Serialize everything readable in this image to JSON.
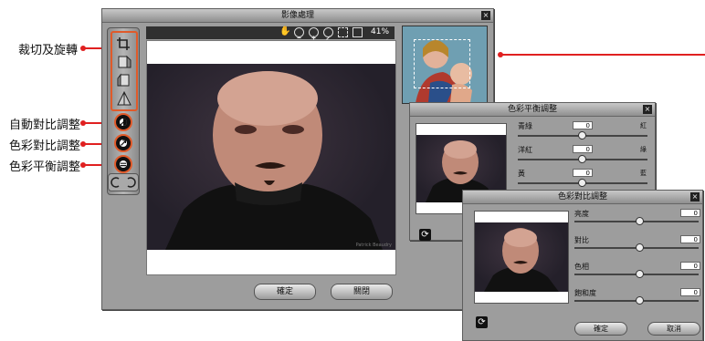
{
  "callouts": [
    {
      "label": "裁切及旋轉"
    },
    {
      "label": "自動對比調整"
    },
    {
      "label": "色彩對比調整"
    },
    {
      "label": "色彩平衡調整"
    }
  ],
  "main_window": {
    "title": "影像處理",
    "close": "×",
    "zoom_level": "41%",
    "ok_label": "確定",
    "close_label": "關閉",
    "watermark": "Patrick Beaudry"
  },
  "balance_window": {
    "title": "色彩平衡調整",
    "close": "×",
    "sliders": [
      {
        "left": "青綠",
        "right": "紅",
        "value": "0"
      },
      {
        "left": "洋紅",
        "right": "綠",
        "value": "0"
      },
      {
        "left": "黃",
        "right": "藍",
        "value": "0"
      }
    ]
  },
  "contrast_window": {
    "title": "色彩對比調整",
    "close": "×",
    "sliders": [
      {
        "label": "亮度",
        "value": "0"
      },
      {
        "label": "對比",
        "value": "0"
      },
      {
        "label": "色相",
        "value": "0"
      },
      {
        "label": "飽和度",
        "value": "0"
      }
    ],
    "ok_label": "確定",
    "cancel_label": "取消"
  },
  "colors": {
    "accent": "#e02020",
    "tool_border": "#e05a2a",
    "panel": "#9d9d9d"
  },
  "icons": [
    "crop-icon",
    "flip-horizontal-icon",
    "flip-vertical-icon",
    "rotate-icon",
    "auto-contrast-icon",
    "color-contrast-icon",
    "color-balance-icon",
    "hand-icon",
    "zoom-out-icon",
    "zoom-in-icon",
    "fit-icon",
    "actual-size-icon",
    "refresh-icon"
  ]
}
